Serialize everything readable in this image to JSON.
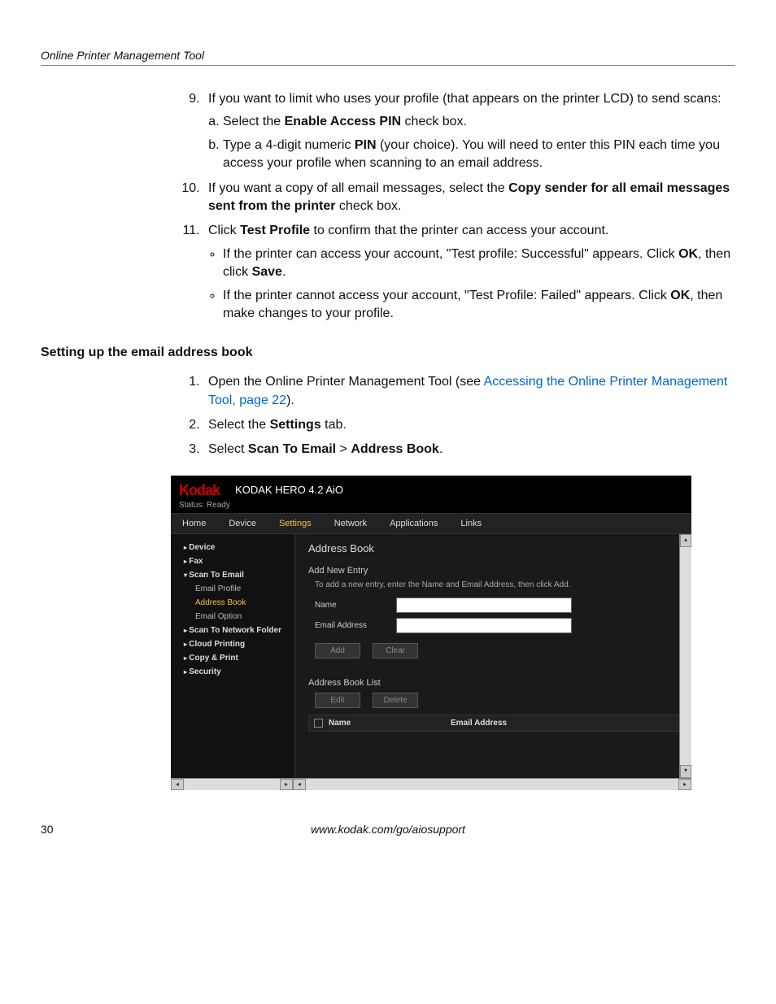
{
  "header": "Online Printer Management Tool",
  "list1": {
    "i9": "If you want to limit who uses your profile (that appears on the printer LCD) to send scans:",
    "i9a_pre": "Select the ",
    "i9a_b": "Enable Access PIN",
    "i9a_post": " check box.",
    "i9b_pre": "Type a 4-digit numeric ",
    "i9b_b": "PIN",
    "i9b_post": " (your choice). You will need to enter this PIN each time you access your profile when scanning to an email address.",
    "i10_pre": "If you want a copy of all email messages, select the ",
    "i10_b": "Copy sender for all email messages sent from the printer",
    "i10_post": " check box.",
    "i11_pre": "Click ",
    "i11_b": "Test Profile",
    "i11_post": " to confirm that the printer can access your account.",
    "i11_bul1_pre": "If the printer can access your account, \"Test profile: Successful\" appears. Click ",
    "i11_bul1_b1": "OK",
    "i11_bul1_mid": ", then click ",
    "i11_bul1_b2": "Save",
    "i11_bul1_post": ".",
    "i11_bul2_pre": "If the printer cannot access your account, \"Test Profile: Failed\" appears. Click ",
    "i11_bul2_b": "OK",
    "i11_bul2_post": ", then make changes to your profile."
  },
  "heading2": "Setting up the email address book",
  "list2": {
    "i1_pre": "Open the Online Printer Management Tool (see ",
    "i1_link": "Accessing the Online Printer Management Tool, page 22",
    "i1_post": ").",
    "i2_pre": "Select the ",
    "i2_b": "Settings",
    "i2_post": " tab.",
    "i3_pre": "Select ",
    "i3_b1": "Scan To Email",
    "i3_mid": " > ",
    "i3_b2": "Address Book",
    "i3_post": "."
  },
  "shot": {
    "brand": "Kodak",
    "model": "KODAK HERO 4.2 AiO",
    "status": "Status: Ready",
    "tabs": [
      "Home",
      "Device",
      "Settings",
      "Network",
      "Applications",
      "Links"
    ],
    "sidebar": {
      "device": "Device",
      "fax": "Fax",
      "scan_email": "Scan To Email",
      "email_profile": "Email Profile",
      "address_book": "Address Book",
      "email_option": "Email Option",
      "scan_network": "Scan To Network Folder",
      "cloud": "Cloud Printing",
      "copy": "Copy & Print",
      "security": "Security"
    },
    "pane": {
      "title": "Address Book",
      "add_entry": "Add New Entry",
      "hint": "To add a new entry, enter the Name and Email Address, then click Add.",
      "name_lbl": "Name",
      "email_lbl": "Email Address",
      "add_btn": "Add",
      "clear_btn": "Clear",
      "list_title": "Address Book List",
      "edit_btn": "Edit",
      "delete_btn": "Delete",
      "col_name": "Name",
      "col_email": "Email Address"
    }
  },
  "footer": {
    "page": "30",
    "url": "www.kodak.com/go/aiosupport"
  }
}
